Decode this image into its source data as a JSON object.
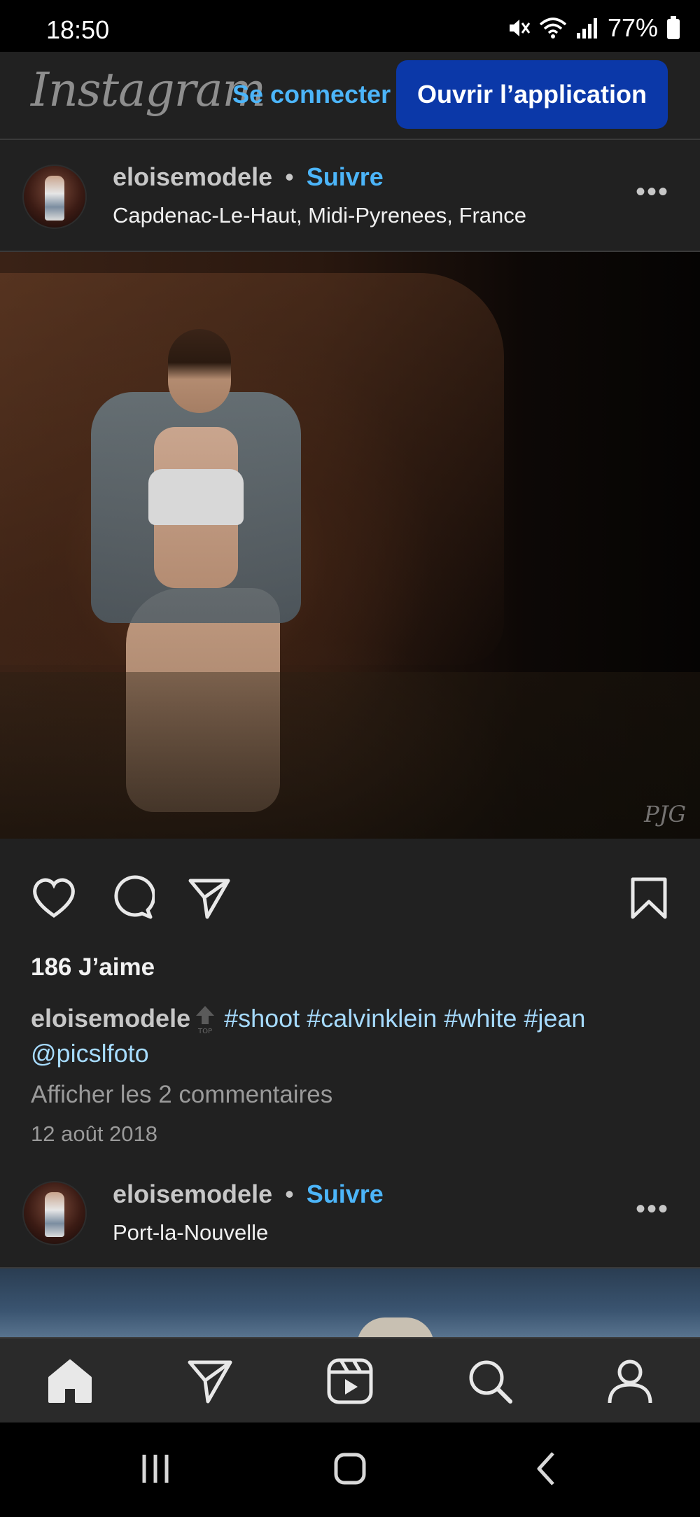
{
  "status_bar": {
    "time": "18:50",
    "battery": "77%",
    "icons": [
      "mute-icon",
      "wifi-icon",
      "signal-icon",
      "battery-icon"
    ]
  },
  "header": {
    "logo": "Instagram",
    "login": "Se connecter",
    "open_app": "Ouvrir l’application"
  },
  "post1": {
    "username": "eloisemodele",
    "dot": "•",
    "follow": "Suivre",
    "location": "Capdenac-Le-Haut, Midi-Pyrenees, France",
    "more": "•••",
    "watermark": "PJG",
    "likes": "186 J’aime",
    "caption_user": "eloisemodele",
    "hashtags": "#shoot #calvinklein #white #jean",
    "mention": "@picslfoto",
    "view_comments": "Afficher les 2 commentaires",
    "date": "12 août 2018",
    "badge_text": "TOP"
  },
  "post2": {
    "username": "eloisemodele",
    "dot": "•",
    "follow": "Suivre",
    "location": "Port-la-Nouvelle",
    "more": "•••"
  },
  "bottom_nav": [
    "home-icon",
    "direct-icon",
    "reels-icon",
    "search-icon",
    "profile-icon"
  ],
  "system_nav": [
    "recents-icon",
    "home-button-icon",
    "back-icon"
  ],
  "colors": {
    "accent": "#4cb5f9",
    "button": "#0b38a8",
    "hashtag": "#a6dbff",
    "background": "#212121"
  }
}
